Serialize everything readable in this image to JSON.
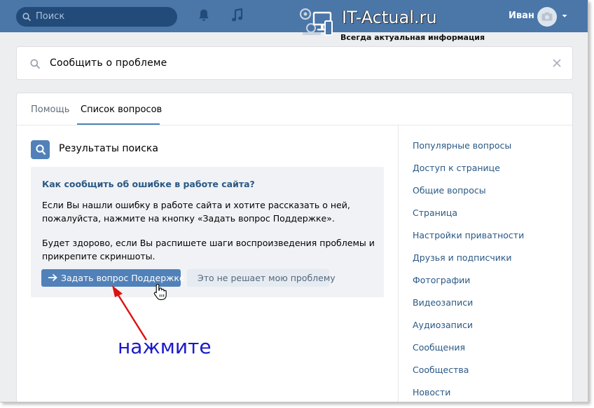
{
  "topbar": {
    "search_placeholder": "Поиск",
    "user_name": "Иван"
  },
  "watermark": {
    "name": "IT-Actual.ru",
    "tagline": "Всегда актуальная информация"
  },
  "help_search": {
    "query": "Сообщить о проблеме"
  },
  "tabs": [
    {
      "label": "Помощь",
      "active": false
    },
    {
      "label": "Список вопросов",
      "active": true
    }
  ],
  "results": {
    "title": "Результаты поиска",
    "question": "Как сообщить об ошибке в работе сайта?",
    "lines": [
      "Если Вы нашли ошибку в работе сайта и хотите рассказать о ней,",
      "пожалуйста, нажмите на кнопку «Задать вопрос Поддержке».",
      "Будет здорово, если Вы распишете шаги воспроизведения проблемы и",
      "прикрепите скриншоты."
    ],
    "ask_button": "Задать вопрос Поддержке",
    "not_solved_button": "Это не решает мою проблему"
  },
  "sidebar": {
    "items": [
      "Популярные вопросы",
      "Доступ к странице",
      "Общие вопросы",
      "Страница",
      "Настройки приватности",
      "Друзья и подписчики",
      "Фотографии",
      "Видеозаписи",
      "Аудиозаписи",
      "Сообщения",
      "Сообщества",
      "Новости"
    ]
  },
  "annotation": {
    "label": "нажмите",
    "color": "#e01010"
  },
  "colors": {
    "header": "#4a76a8",
    "accent": "#5181b8",
    "link": "#2a5885"
  }
}
